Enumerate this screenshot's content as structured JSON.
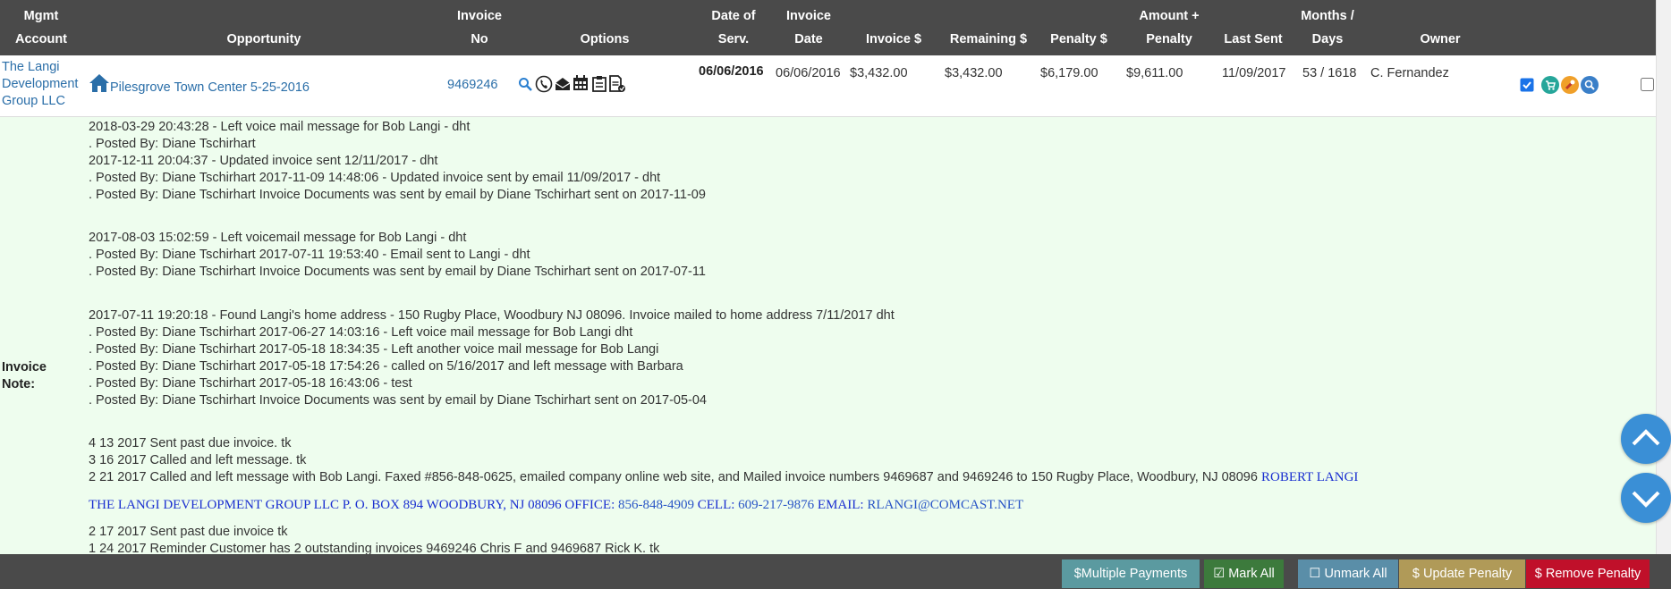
{
  "header": {
    "mgmt_account": [
      "Mgmt",
      "Account"
    ],
    "opportunity": "Opportunity",
    "invoice_no": [
      "Invoice",
      "No"
    ],
    "options": "Options",
    "date_of_serv": [
      "Date of",
      "Serv."
    ],
    "invoice_date": [
      "Invoice",
      "Date"
    ],
    "invoice_amount": "Invoice $",
    "remaining": "Remaining $",
    "penalty": "Penalty $",
    "amount_penalty": [
      "Amount +",
      "Penalty"
    ],
    "last_sent": "Last Sent",
    "months_days": [
      "Months /",
      "Days"
    ],
    "owner": "Owner"
  },
  "row": {
    "account": [
      "The Langi",
      "Development",
      "Group LLC"
    ],
    "opportunity": "Pilesgrove Town Center 5-25-2016",
    "invoice_no": "9469246",
    "date_of_serv": "06/06/2016",
    "invoice_date": "06/06/2016",
    "invoice_amount": "$3,432.00",
    "remaining": "$3,432.00",
    "penalty": "$6,179.00",
    "amount_penalty": "$9,611.00",
    "last_sent": "11/09/2017",
    "months_days": "53 / 1618",
    "owner": "C. Fernandez",
    "option_icons": [
      "search-icon",
      "phone-icon",
      "envelope-open-icon",
      "calendar-icon",
      "clipboard-icon",
      "document-icon"
    ],
    "action_icons": [
      "cart-icon",
      "tool-icon",
      "search-icon"
    ],
    "colors": {
      "cart": "#26a69a",
      "tool": "#f0a02a",
      "search": "#3a7fc8"
    }
  },
  "note": {
    "label": [
      "Invoice",
      "Note:"
    ],
    "lines": [
      "2018-03-29 20:43:28 - Left voice mail message for Bob Langi - dht",
      ". Posted By: Diane Tschirhart",
      "2017-12-11 20:04:37 - Updated invoice sent 12/11/2017 - dht",
      ". Posted By: Diane Tschirhart 2017-11-09 14:48:06 - Updated invoice sent by email 11/09/2017 - dht",
      ". Posted By: Diane Tschirhart Invoice Documents was sent by email by Diane Tschirhart sent on 2017-11-09",
      "2017-08-03 15:02:59 - Left voicemail message for Bob Langi - dht",
      ". Posted By: Diane Tschirhart 2017-07-11 19:53:40 - Email sent to Langi - dht",
      ". Posted By: Diane Tschirhart Invoice Documents was sent by email by Diane Tschirhart sent on 2017-07-11",
      "2017-07-11 19:20:18 - Found Langi's home address - 150 Rugby Place, Woodbury NJ 08096.  Invoice mailed to home address 7/11/2017 dht",
      ". Posted By: Diane Tschirhart 2017-06-27 14:03:16 - Left voice mail message for Bob Langi dht",
      ". Posted By: Diane Tschirhart 2017-05-18 18:34:35 - Left another voice mail message for Bob Langi",
      ". Posted By: Diane Tschirhart 2017-05-18 17:54:26 - called on 5/16/2017 and left message with Barbara",
      ". Posted By: Diane Tschirhart 2017-05-18 16:43:06 - test",
      ". Posted By: Diane Tschirhart Invoice Documents was sent by email by Diane Tschirhart sent on 2017-05-04",
      "4 13 2017 Sent past due invoice. tk",
      "3 16 2017 Called and left message. tk",
      "2 21 2017 Called and left message with Bob Langi. Faxed #856-848-0625, emailed company online web site, and Mailed invoice numbers 9469687 and 9469246 to 150 Rugby Place, Woodbury, NJ 08096",
      "ROBERT LANGI",
      "THE LANGI DEVELOPMENT GROUP LLC P. O. BOX 894 WOODBURY, NJ  08096 OFFICE:",
      "856-848-4909",
      "CELL:",
      "609-217-9876",
      "EMAIL:",
      "RLANGI@COMCAST.NET",
      "2 17 2017 Sent past due invoice tk",
      "1 24 2017 Reminder Customer has 2 outstanding invoices 9469246 Chris F and 9469687 Rick K. tk"
    ]
  },
  "buttons": {
    "multiple_payments": "$Multiple Payments",
    "mark_all": "Mark All",
    "unmark_all": "Unmark All",
    "update_penalty": "$ Update Penalty",
    "remove_penalty": "$ Remove Penalty",
    "colors": {
      "multiple_payments": "#5b9aa0",
      "mark_all": "#3c7a3c",
      "unmark_all": "#5a8ea8",
      "update_penalty": "#b09a58",
      "remove_penalty": "#c0102a"
    }
  },
  "scroll_buttons": [
    "chevron-up-icon",
    "chevron-down-icon"
  ]
}
